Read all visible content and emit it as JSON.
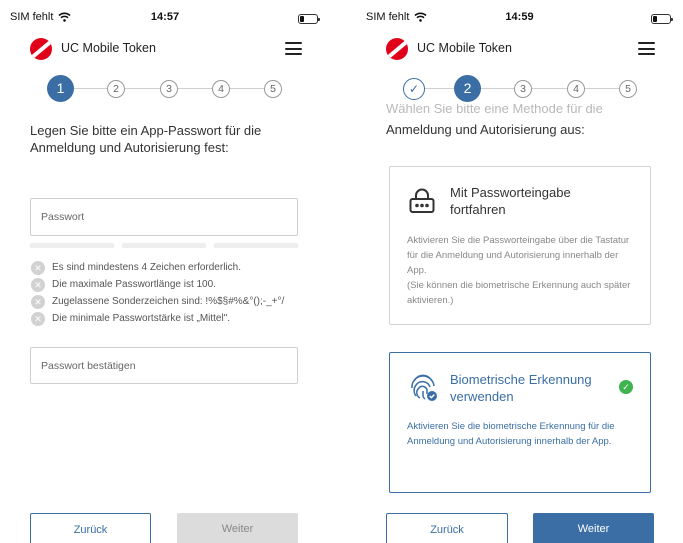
{
  "left_screen": {
    "status": {
      "carrier": "SIM fehlt",
      "time": "14:57"
    },
    "header": {
      "title": "UC Mobile Token"
    },
    "stepper": {
      "steps": [
        "1",
        "2",
        "3",
        "4",
        "5"
      ]
    },
    "intro_text": "Legen Sie bitte ein App-Passwort für die Anmeldung und Autorisierung fest:",
    "password_placeholder": "Passwort",
    "rules": [
      "Es sind mindestens 4 Zeichen erforderlich.",
      "Die maximale Passwortlänge ist 100.",
      "Zugelassene Sonderzeichen sind: !%$§#%&°();-_+°/",
      "Die minimale Passwortstärke ist „Mittel\"."
    ],
    "confirm_placeholder": "Passwort bestätigen",
    "buttons": {
      "back": "Zurück",
      "next": "Weiter"
    }
  },
  "right_screen": {
    "status": {
      "carrier": "SIM fehlt",
      "time": "14:59"
    },
    "header": {
      "title": "UC Mobile Token"
    },
    "stepper": {
      "steps": [
        "✓",
        "2",
        "3",
        "4",
        "5"
      ]
    },
    "partial_text": "Wählen Sie bitte eine Methode für die",
    "intro_text": "Anmeldung und Autorisierung aus:",
    "card_password": {
      "title": "Mit Passworteingabe fortfahren",
      "desc": "Aktivieren Sie die Passworteingabe über die Tastatur für die Anmeldung und Autorisierung innerhalb der App.",
      "desc2": "(Sie können die biometrische Erkennung auch später aktivieren.)"
    },
    "card_biometric": {
      "title": "Biometrische Erkennung verwenden",
      "desc": "Aktivieren Sie die biometrische Erkennung für die Anmeldung und Autorisierung innerhalb der App.",
      "check": "✓"
    },
    "buttons": {
      "back": "Zurück",
      "next": "Weiter"
    }
  },
  "icons": [
    "wifi-icon",
    "battery-icon",
    "unicredit-logo-icon",
    "menu-icon",
    "lock-keypad-icon",
    "fingerprint-icon",
    "check-icon",
    "close-icon"
  ],
  "colors": {
    "brand_red": "#e1001a",
    "primary_blue": "#3a6ea5",
    "success_green": "#3fb34f",
    "disabled_gray": "#dcdcdc"
  }
}
